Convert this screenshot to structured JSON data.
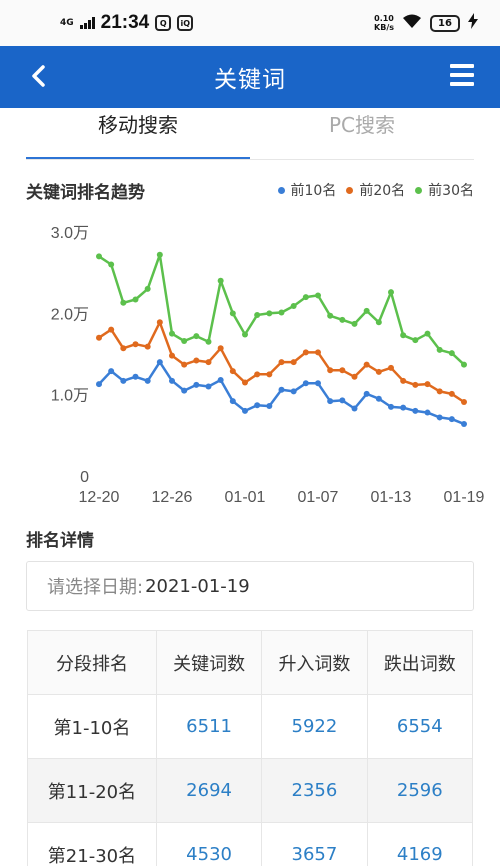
{
  "status_bar": {
    "network": "4G",
    "time": "21:34",
    "speed": "0.10\nKB/s",
    "battery": "16"
  },
  "appbar": {
    "title": "关键词",
    "back_icon": "back-arrow-icon",
    "menu_icon": "hamburger-menu-icon"
  },
  "tabs": [
    {
      "label": "移动搜索",
      "active": true
    },
    {
      "label": "PC搜索",
      "active": false
    }
  ],
  "chart": {
    "title": "关键词排名趋势",
    "legend": [
      {
        "label": "前10名",
        "color": "#3a7ed6"
      },
      {
        "label": "前20名",
        "color": "#e06a1e"
      },
      {
        "label": "前30名",
        "color": "#5cc04c"
      }
    ]
  },
  "chart_data": {
    "type": "line",
    "x": [
      "12-20",
      "12-21",
      "12-22",
      "12-23",
      "12-24",
      "12-25",
      "12-26",
      "12-27",
      "12-28",
      "12-29",
      "12-30",
      "12-31",
      "01-01",
      "01-02",
      "01-03",
      "01-04",
      "01-05",
      "01-06",
      "01-07",
      "01-08",
      "01-09",
      "01-10",
      "01-11",
      "01-12",
      "01-13",
      "01-14",
      "01-15",
      "01-16",
      "01-17",
      "01-18",
      "01-19"
    ],
    "x_tick_labels": [
      "12-20",
      "12-26",
      "01-01",
      "01-07",
      "01-13",
      "01-19"
    ],
    "y_tick_labels": [
      "0",
      "1.0万",
      "2.0万",
      "3.0万"
    ],
    "ylim": [
      0,
      30000
    ],
    "series": [
      {
        "name": "前10名",
        "color": "#3a7ed6",
        "values": [
          11300,
          12900,
          11700,
          12200,
          11700,
          14000,
          11700,
          10500,
          11200,
          11000,
          11800,
          9200,
          8000,
          8700,
          8600,
          10600,
          10400,
          11400,
          11400,
          9200,
          9300,
          8300,
          10100,
          9500,
          8500,
          8400,
          8000,
          7800,
          7200,
          7000,
          6400
        ]
      },
      {
        "name": "前20名",
        "color": "#e06a1e",
        "values": [
          17000,
          18000,
          15700,
          16200,
          15900,
          18900,
          14800,
          13700,
          14200,
          14000,
          15700,
          12900,
          11500,
          12500,
          12500,
          14000,
          14000,
          15200,
          15200,
          13000,
          13000,
          12200,
          13700,
          12800,
          13300,
          11700,
          11200,
          11300,
          10400,
          10100,
          9100
        ]
      },
      {
        "name": "前30名",
        "color": "#5cc04c",
        "values": [
          27000,
          26000,
          21300,
          21700,
          23000,
          27200,
          17500,
          16600,
          17200,
          16500,
          24000,
          20000,
          17400,
          19800,
          20000,
          20100,
          20900,
          22000,
          22200,
          19700,
          19200,
          18700,
          20300,
          18900,
          22600,
          17300,
          16700,
          17500,
          15500,
          15100,
          13700
        ]
      }
    ]
  },
  "details": {
    "title": "排名详情",
    "date_label": "请选择日期:",
    "date_value": "2021-01-19",
    "headers": [
      "分段排名",
      "关键词数",
      "升入词数",
      "跌出词数"
    ],
    "rows": [
      [
        "第1-10名",
        "6511",
        "5922",
        "6554"
      ],
      [
        "第11-20名",
        "2694",
        "2356",
        "2596"
      ],
      [
        "第21-30名",
        "4530",
        "3657",
        "4169"
      ]
    ]
  }
}
